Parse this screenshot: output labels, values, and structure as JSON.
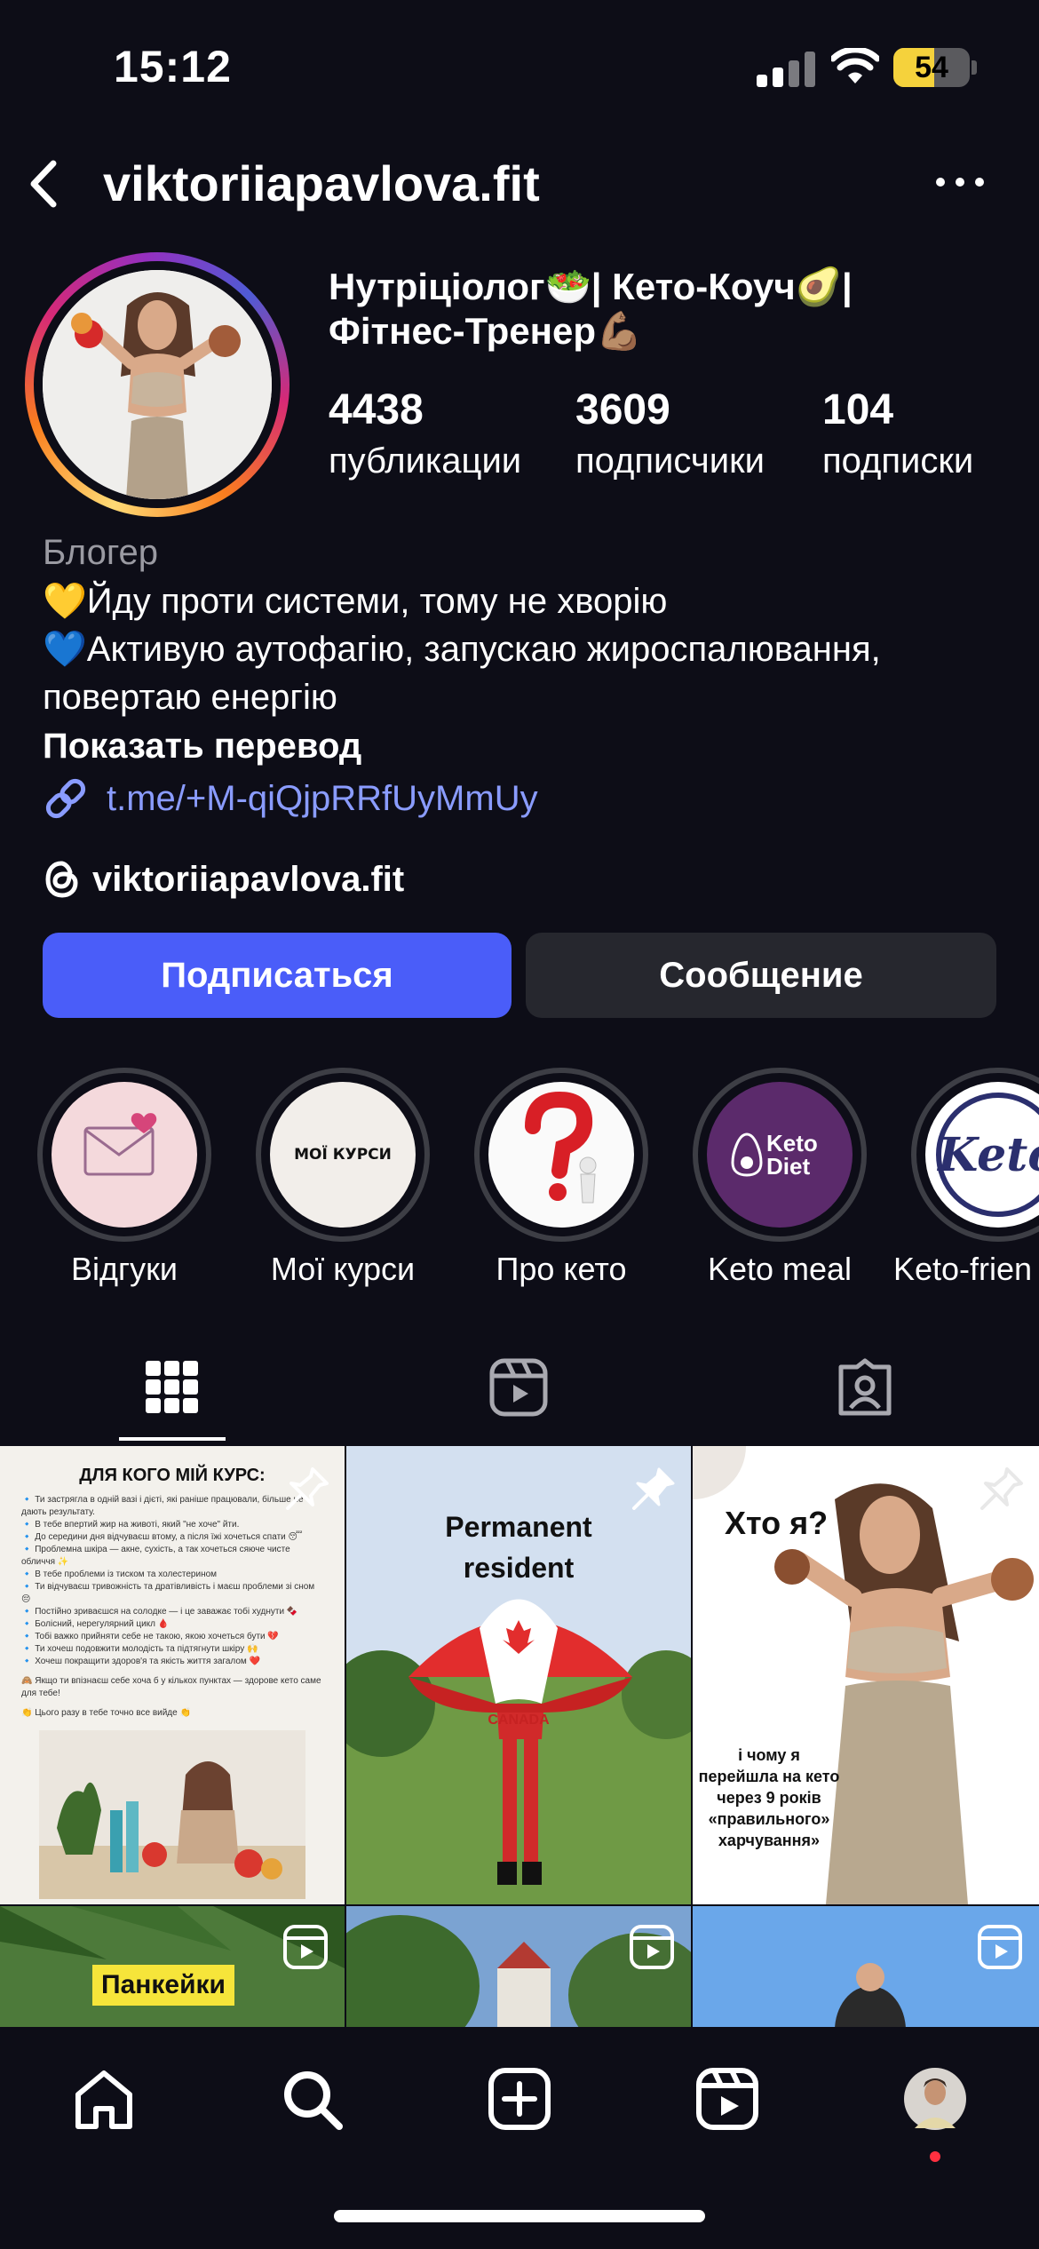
{
  "status_bar": {
    "time": "15:12",
    "battery": "54",
    "battery_fraction": 0.54
  },
  "header": {
    "username": "viktoriiapavlova.fit",
    "back_icon": "chevron-left-icon",
    "more_icon": "more-horizontal-icon"
  },
  "profile": {
    "bio_title_line1": "Нутріціолог🥗| Кето-Коуч🥑|",
    "bio_title_line2": "Фітнес-Тренер💪🏽",
    "stats": [
      {
        "value": "4438",
        "label": "публикации"
      },
      {
        "value": "3609",
        "label": "подписчики"
      },
      {
        "value": "104",
        "label": "подписки"
      }
    ],
    "category": "Блогер",
    "bio_lines": [
      "💛Йду проти системи, тому не хворію",
      "💙Активую аутофагію, запускаю жироспалювання,",
      "повертаю енергію"
    ],
    "show_translation": "Показать перевод",
    "link": "t.me/+M-qiQjpRRfUyMmUy",
    "threads_handle": "viktoriiapavlova.fit"
  },
  "buttons": {
    "follow": "Подписаться",
    "message": "Сообщение"
  },
  "highlights": [
    {
      "label": "Відгуки"
    },
    {
      "label": "Мої курси",
      "cover_text": "МОЇ КУРСИ"
    },
    {
      "label": "Про кето"
    },
    {
      "label": "Keto meal",
      "cover_text": "Keto Diet"
    },
    {
      "label": "Keto-frien",
      "cover_text": "Keto"
    }
  ],
  "tabs": [
    "grid-icon",
    "reels-icon",
    "tagged-icon"
  ],
  "posts": [
    {
      "title": "ДЛЯ КОГО МІЙ КУРС:",
      "badge": "pin-icon",
      "lines": [
        "🔹 Ти застрягла в одній вазі і дієті, які раніше працювали, більше не дають результату.",
        "🔹 В тебе впертий жир на животі, який \"не хоче\" йти.",
        "🔹 До середини дня відчуваєш втому, а після їжі хочеться спати 😴",
        "🔹 Проблемна шкіра — акне, сухість, а так хочеться сяюче чисте обличчя ✨",
        "🔹 В тебе проблеми із тиском та холестерином",
        "🔹 Ти відчуваєш тривожність та дратівливість і маєш проблеми зі сном 😔",
        "🔹 Постійно зриваєшся на солодке — і це заважає тобі худнути 🍫",
        "🔹 Болісний, нерегулярний цикл 🩸",
        "🔹 Тобі важко прийняти себе не такою, якою хочеться бути 💔",
        "🔹 Ти хочеш подовжити молодість та підтягнути шкіру 🙌",
        "🔹 Хочеш покращити здоров'я та якість життя загалом ❤️"
      ],
      "footer1": "🙈 Якщо ти впізнаєш себе хоча б у кількох пунктах — здорове кето саме для тебе!",
      "footer2": "👏 Цього разу в тебе точно все вийде 👏"
    },
    {
      "title": "Permanent resident",
      "umbrella_text": "CANADA",
      "badge": "pin-icon"
    },
    {
      "title": "Хто я?",
      "caption": "і чому я перейшла на кето через 9 років «правильного» харчування»",
      "badge": "pin-icon"
    },
    {
      "title": "Панкейки",
      "badge": "reels-icon"
    },
    {
      "badge": "reels-icon"
    },
    {
      "badge": "reels-icon"
    }
  ],
  "bottom_nav": [
    "home-icon",
    "search-icon",
    "create-icon",
    "reels-icon",
    "profile-avatar"
  ],
  "colors": {
    "background": "#0d0d17",
    "follow_button": "#4a5df9",
    "message_button": "#26272e",
    "link": "#8a9cff",
    "battery": "#f5d23c"
  }
}
